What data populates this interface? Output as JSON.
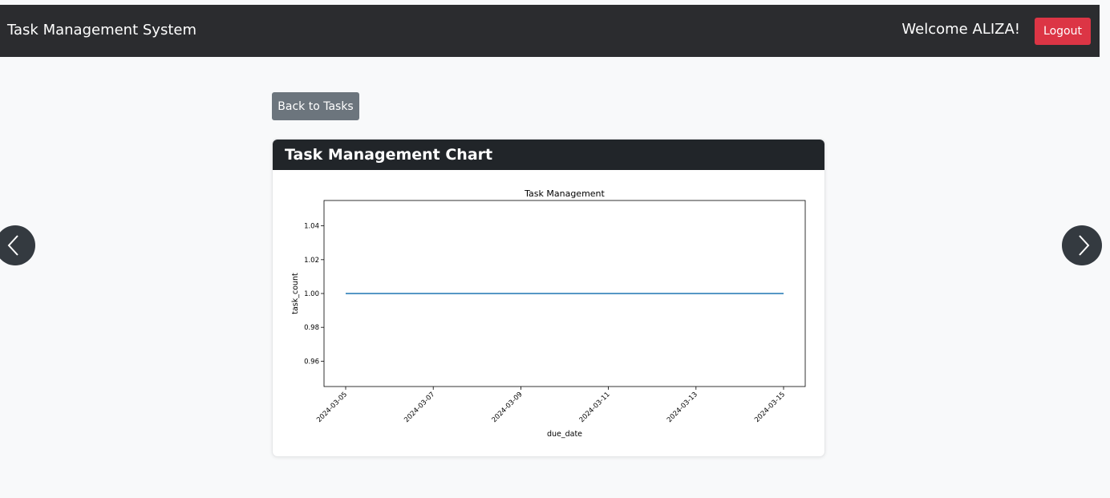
{
  "navbar": {
    "brand": "Task Management System",
    "welcome": "Welcome ALIZA!",
    "logout_label": "Logout"
  },
  "actions": {
    "back_label": "Back to Tasks"
  },
  "card": {
    "title": "Task Management Chart"
  },
  "carousel": {
    "prev_icon": "chevron-left-icon",
    "next_icon": "chevron-right-icon"
  },
  "colors": {
    "navbar_bg": "#2b2c2f",
    "logout_bg": "#dc3545",
    "back_bg": "#6c757d",
    "card_header_bg": "#212529",
    "series_line": "#1f77b4"
  },
  "chart_data": {
    "type": "line",
    "title": "Task Management",
    "xlabel": "due_date",
    "ylabel": "task_count",
    "x": [
      "2024-03-05",
      "2024-03-15"
    ],
    "y": [
      1.0,
      1.0
    ],
    "xticks": [
      "2024-03-05",
      "2024-03-07",
      "2024-03-09",
      "2024-03-11",
      "2024-03-13",
      "2024-03-15"
    ],
    "yticks": [
      "0.96",
      "0.98",
      "1.00",
      "1.02",
      "1.04"
    ],
    "ylim": [
      0.945,
      1.055
    ],
    "grid": false
  }
}
